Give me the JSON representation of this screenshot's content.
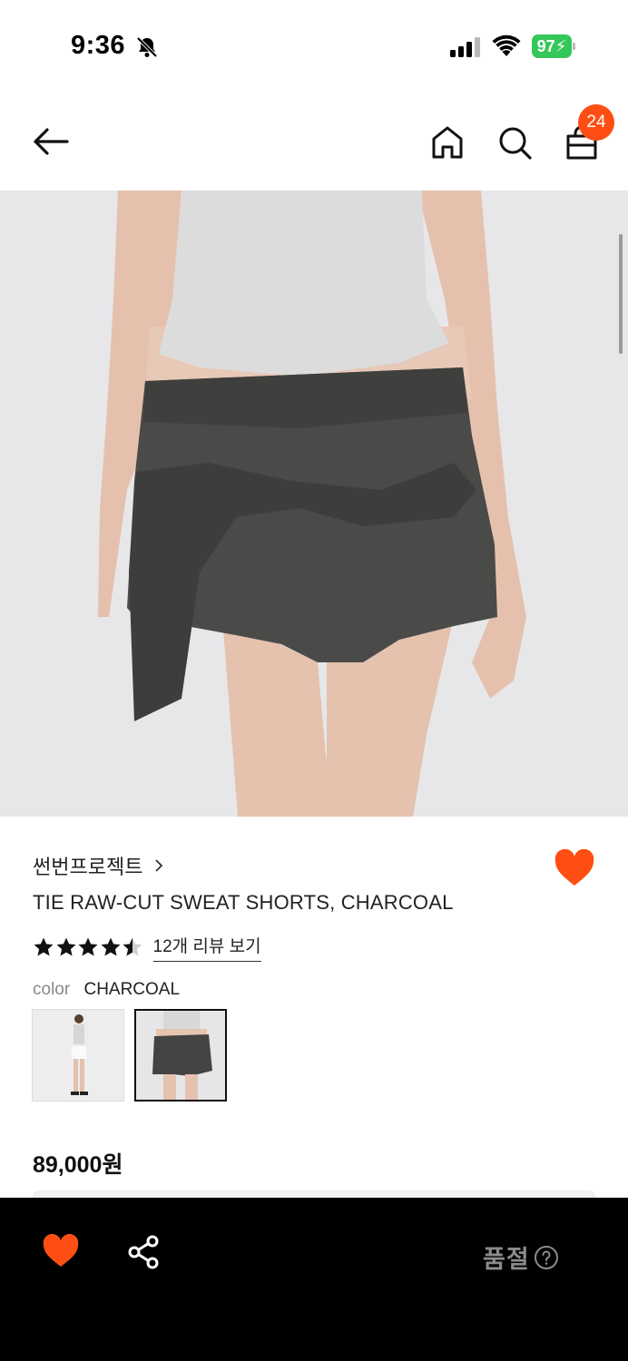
{
  "status_bar": {
    "time": "9:36",
    "battery": "97",
    "icons": [
      "bell-slash-icon",
      "cellular-signal-icon",
      "wifi-icon",
      "battery-charging-icon"
    ]
  },
  "header": {
    "icons": [
      "arrow-left-icon",
      "home-icon",
      "search-icon",
      "shopping-bag-icon"
    ],
    "cart_count": "24",
    "accent_color": "#ff4e14"
  },
  "product": {
    "brand": "썬번프로젝트",
    "title": "TIE RAW-CUT SWEAT SHORTS, CHARCOAL",
    "rating": 4.5,
    "review_link": "12개 리뷰 보기",
    "color_label": "color",
    "color_value": "CHARCOAL",
    "swatches": [
      "white-variant",
      "charcoal-variant"
    ],
    "selected_swatch": "charcoal-variant",
    "price": "89,000원",
    "wishlisted": true
  },
  "bottom_bar": {
    "status": "품절",
    "icons": [
      "heart-icon",
      "share-icon",
      "question-circle-icon"
    ]
  }
}
